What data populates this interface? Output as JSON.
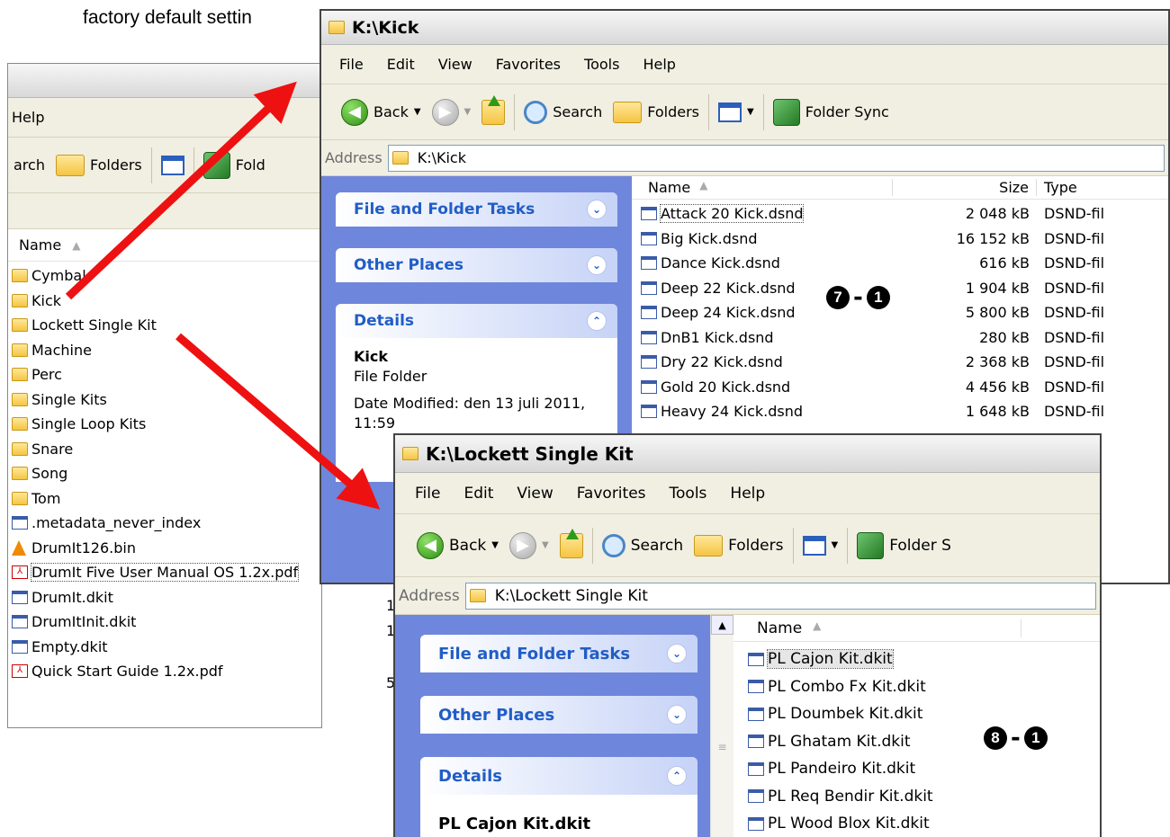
{
  "intro_text": "factory default settin",
  "back_window": {
    "menu": [
      "Help"
    ],
    "toolbar": {
      "search": "arch",
      "folders": "Folders",
      "sync": "Fold"
    },
    "column_name": "Name",
    "items": [
      {
        "name": "Cymbal",
        "kind": "folder"
      },
      {
        "name": "Kick",
        "kind": "folder"
      },
      {
        "name": "Lockett Single Kit",
        "kind": "folder"
      },
      {
        "name": "Machine",
        "kind": "folder"
      },
      {
        "name": "Perc",
        "kind": "folder"
      },
      {
        "name": "Single Kits",
        "kind": "folder"
      },
      {
        "name": "Single Loop Kits",
        "kind": "folder"
      },
      {
        "name": "Snare",
        "kind": "folder"
      },
      {
        "name": "Song",
        "kind": "folder"
      },
      {
        "name": "Tom",
        "kind": "folder"
      },
      {
        "name": ".metadata_never_index",
        "kind": "doc"
      },
      {
        "name": "DrumIt126.bin",
        "kind": "cone"
      },
      {
        "name": "DrumIt Five User Manual OS 1.2x.pdf",
        "kind": "pdf"
      },
      {
        "name": "DrumIt.dkit",
        "kind": "doc"
      },
      {
        "name": "DrumItInit.dkit",
        "kind": "doc"
      },
      {
        "name": "Empty.dkit",
        "kind": "doc"
      },
      {
        "name": "Quick Start Guide 1.2x.pdf",
        "kind": "pdf"
      }
    ],
    "size_digits": [
      "1",
      "1",
      "5"
    ]
  },
  "kick_window": {
    "title": "K:\\Kick",
    "menu": [
      "File",
      "Edit",
      "View",
      "Favorites",
      "Tools",
      "Help"
    ],
    "toolbar": {
      "back": "Back",
      "search": "Search",
      "folders": "Folders",
      "sync": "Folder Sync"
    },
    "address_label": "Address",
    "address_value": "K:\\Kick",
    "tasks": {
      "file_folder_tasks": "File and Folder Tasks",
      "other_places": "Other Places",
      "details": "Details",
      "detail_name": "Kick",
      "detail_type": "File Folder",
      "detail_modified": "Date Modified: den 13 juli 2011, 11:59"
    },
    "columns": {
      "name": "Name",
      "size": "Size",
      "type": "Type"
    },
    "files": [
      {
        "name": "Attack 20 Kick.dsnd",
        "size": "2 048 kB",
        "type": "DSND-fil"
      },
      {
        "name": "Big Kick.dsnd",
        "size": "16 152 kB",
        "type": "DSND-fil"
      },
      {
        "name": "Dance Kick.dsnd",
        "size": "616 kB",
        "type": "DSND-fil"
      },
      {
        "name": "Deep 22 Kick.dsnd",
        "size": "1 904 kB",
        "type": "DSND-fil"
      },
      {
        "name": "Deep 24 Kick.dsnd",
        "size": "5 800 kB",
        "type": "DSND-fil"
      },
      {
        "name": "DnB1 Kick.dsnd",
        "size": "280 kB",
        "type": "DSND-fil"
      },
      {
        "name": "Dry 22 Kick.dsnd",
        "size": "2 368 kB",
        "type": "DSND-fil"
      },
      {
        "name": "Gold 20 Kick.dsnd",
        "size": "4 456 kB",
        "type": "DSND-fil"
      },
      {
        "name": "Heavy 24 Kick.dsnd",
        "size": "1 648 kB",
        "type": "DSND-fil"
      }
    ],
    "badge": {
      "left": "7",
      "dash": "-",
      "right": "1"
    }
  },
  "lockett_window": {
    "title": "K:\\Lockett Single Kit",
    "menu": [
      "File",
      "Edit",
      "View",
      "Favorites",
      "Tools",
      "Help"
    ],
    "toolbar": {
      "back": "Back",
      "search": "Search",
      "folders": "Folders",
      "sync": "Folder S"
    },
    "address_label": "Address",
    "address_value": "K:\\Lockett Single Kit",
    "tasks": {
      "file_folder_tasks": "File and Folder Tasks",
      "other_places": "Other Places",
      "details": "Details",
      "detail_name": "PL Cajon Kit.dkit"
    },
    "columns": {
      "name": "Name"
    },
    "files": [
      {
        "name": "PL Cajon Kit.dkit"
      },
      {
        "name": "PL Combo Fx Kit.dkit"
      },
      {
        "name": "PL Doumbek Kit.dkit"
      },
      {
        "name": "PL Ghatam Kit.dkit"
      },
      {
        "name": "PL Pandeiro Kit.dkit"
      },
      {
        "name": "PL Req Bendir Kit.dkit"
      },
      {
        "name": "PL Wood Blox Kit.dkit"
      }
    ],
    "badge": {
      "left": "8",
      "dash": "-",
      "right": "1"
    }
  },
  "colors": {
    "arrow": "#ee1111",
    "task_pane": "#6e86dc",
    "task_header_text": "#215dc6"
  }
}
